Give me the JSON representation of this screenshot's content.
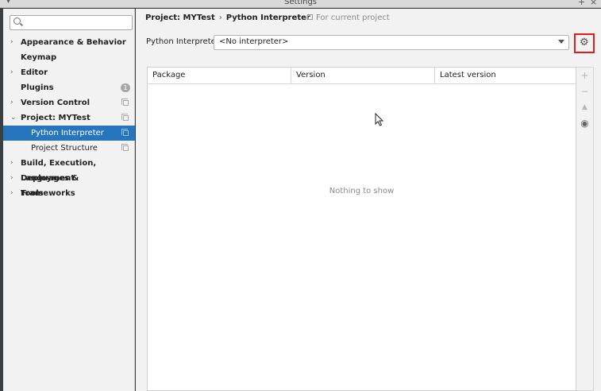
{
  "window": {
    "title": "Settings",
    "controls": [
      "+",
      "×"
    ]
  },
  "sidebar": {
    "search": {
      "value": "",
      "placeholder": ""
    },
    "items": [
      {
        "label": "Appearance & Behavior",
        "arrow": "›"
      },
      {
        "label": "Keymap"
      },
      {
        "label": "Editor",
        "arrow": "›"
      },
      {
        "label": "Plugins",
        "badge": "1"
      },
      {
        "label": "Version Control",
        "arrow": "›"
      },
      {
        "label": "Project: MYTest",
        "arrow": "⌄"
      },
      {
        "label": "Python Interpreter",
        "selected": true
      },
      {
        "label": "Project Structure"
      },
      {
        "label": "Build, Execution, Deployment",
        "arrow": "›"
      },
      {
        "label": "Languages & Frameworks",
        "arrow": "›"
      },
      {
        "label": "Tools",
        "arrow": "›"
      }
    ]
  },
  "breadcrumb": {
    "project": "Project: MYTest",
    "separator": "›",
    "page": "Python Interpreter",
    "scope": "For current project"
  },
  "interpreter": {
    "label": "Python Interpreter:",
    "value": "<No interpreter>",
    "settings_icon": "gear-icon"
  },
  "table": {
    "columns": [
      "Package",
      "Version",
      "Latest version"
    ],
    "empty_text": "Nothing to show"
  },
  "toolbar": {
    "add": "+",
    "remove": "−",
    "upgrade": "▲",
    "show": "◉"
  },
  "colors": {
    "selection": "#2675bf",
    "highlight_box": "#e31b1b"
  }
}
